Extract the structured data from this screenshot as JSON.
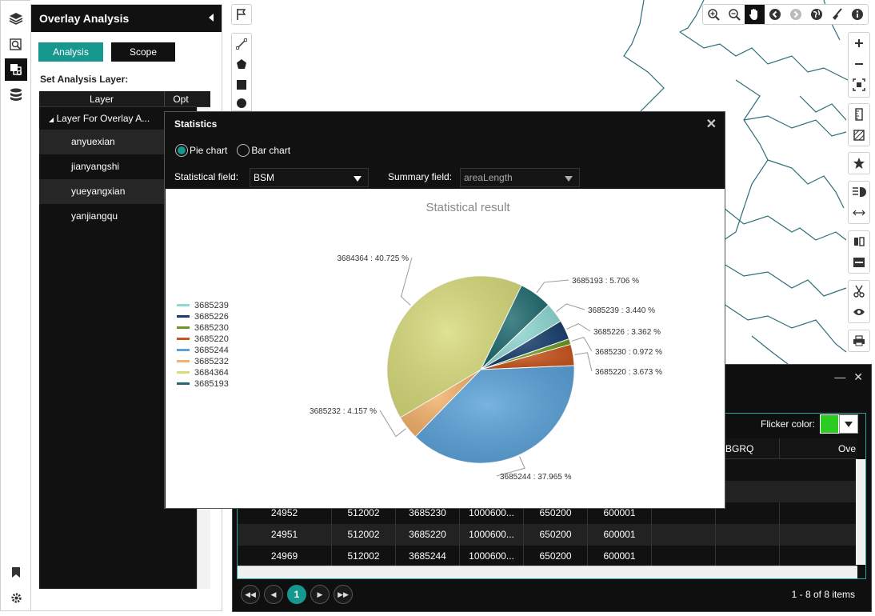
{
  "overlay_panel": {
    "title": "Overlay Analysis",
    "tab_analysis": "Analysis",
    "tab_scope": "Scope",
    "set_layer_label": "Set Analysis Layer:",
    "col_layer": "Layer",
    "col_opt": "Opt",
    "root_label": "Layer For Overlay A...",
    "layers": [
      "anyuexian",
      "jianyangshi",
      "yueyangxian",
      "yanjiangqu"
    ]
  },
  "statistics": {
    "title": "Statistics",
    "radio_pie": "Pie chart",
    "radio_bar": "Bar chart",
    "selected_chart": "Pie chart",
    "stat_field_label": "Statistical field:",
    "stat_field_value": "BSM",
    "summary_field_label": "Summary field:",
    "summary_field_value": "areaLength"
  },
  "attribute_table": {
    "flicker_label": "Flicker color:",
    "flicker_color": "#2ccb21",
    "col_bgrq": "BGRQ",
    "col_ove": "Ove",
    "rows": [
      [
        "24952",
        "512002",
        "3685230",
        "1000600...",
        "650200",
        "600001"
      ],
      [
        "24951",
        "512002",
        "3685220",
        "1000600...",
        "650200",
        "600001"
      ],
      [
        "24969",
        "512002",
        "3685244",
        "1000600...",
        "650200",
        "600001"
      ]
    ],
    "current_page": "1",
    "page_info": "1 - 8 of 8 items"
  },
  "chart_data": {
    "type": "pie",
    "title": "Statistical result",
    "slices": [
      {
        "name": "3685193",
        "percent": 5.706,
        "color": "#1f6b6f",
        "label": "3685193 : 5.706 %"
      },
      {
        "name": "3685239",
        "percent": 3.44,
        "color": "#8fd8d2",
        "label": "3685239 : 3.440 %"
      },
      {
        "name": "3685226",
        "percent": 3.362,
        "color": "#163d6b",
        "label": "3685226 : 3.362 %"
      },
      {
        "name": "3685230",
        "percent": 0.972,
        "color": "#6a9a1f",
        "label": "3685230 : 0.972 %"
      },
      {
        "name": "3685220",
        "percent": 3.673,
        "color": "#c9541c",
        "label": "3685220 : 3.673 %"
      },
      {
        "name": "3685244",
        "percent": 37.965,
        "color": "#5ba3da",
        "label": "3685244 : 37.965 %"
      },
      {
        "name": "3685232",
        "percent": 4.157,
        "color": "#f5b26b",
        "label": "3685232 : 4.157 %"
      },
      {
        "name": "3684364",
        "percent": 40.725,
        "color": "#d9dc7c",
        "label": "3684364 : 40.725 %"
      }
    ],
    "legend": [
      "3685239",
      "3685226",
      "3685230",
      "3685220",
      "3685244",
      "3685232",
      "3684364",
      "3685193"
    ],
    "legend_placement": "left"
  }
}
